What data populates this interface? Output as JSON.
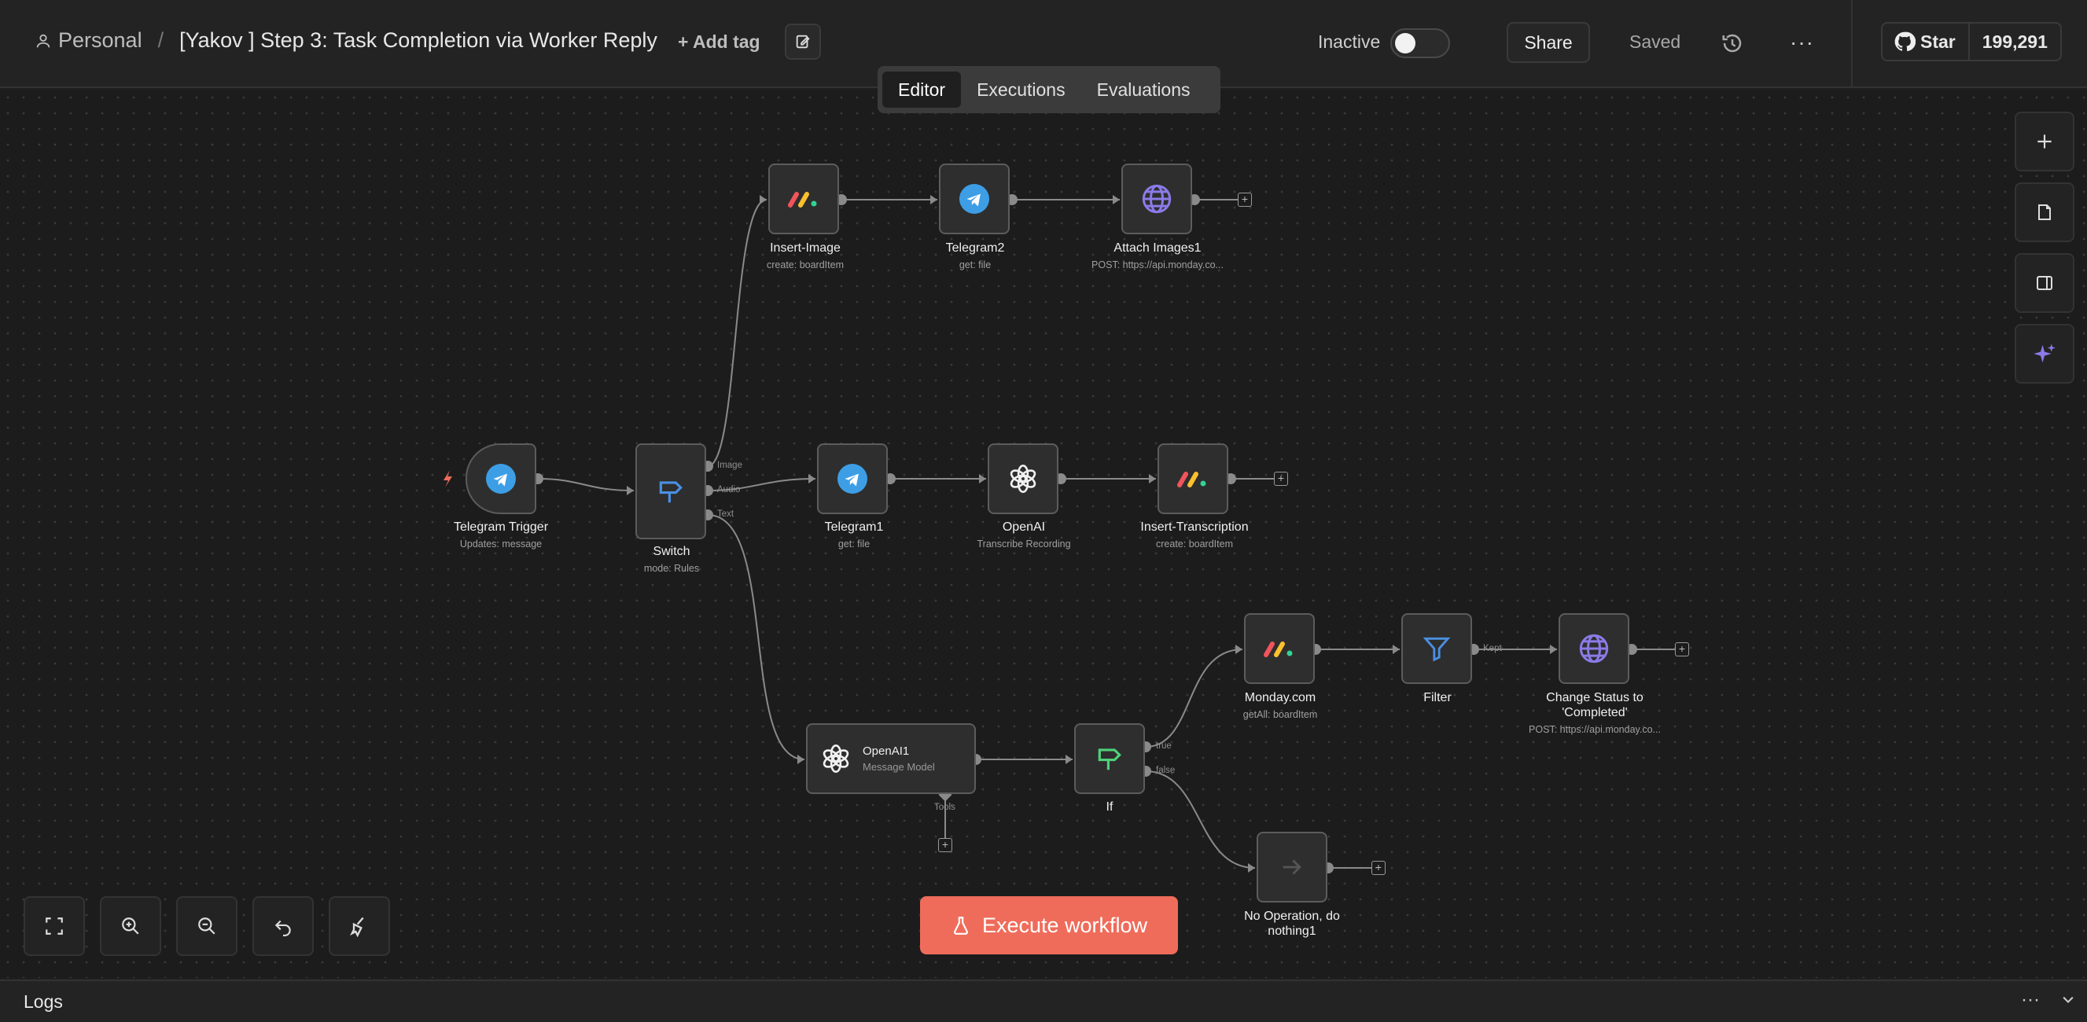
{
  "header": {
    "workspace": "Personal",
    "separator": "/",
    "workflow_title": "[Yakov ] Step 3: Task Completion via Worker Reply",
    "add_tag": "+ Add tag",
    "status_label": "Inactive",
    "active": false,
    "share": "Share",
    "save_state": "Saved",
    "more": "···",
    "github_star": "Star",
    "github_count": "199,291"
  },
  "tabs": [
    {
      "label": "Editor",
      "active": true
    },
    {
      "label": "Executions",
      "active": false
    },
    {
      "label": "Evaluations",
      "active": false
    }
  ],
  "nodes": {
    "telegram_trigger": {
      "label": "Telegram Trigger",
      "sub": "Updates: message",
      "icon": "telegram-icon"
    },
    "switch": {
      "label": "Switch",
      "sub": "mode: Rules",
      "icon": "switch-icon",
      "ports": [
        "Image",
        "Audio",
        "Text"
      ]
    },
    "insert_image": {
      "label": "Insert-Image",
      "sub": "create: boardItem",
      "icon": "monday-icon"
    },
    "telegram2": {
      "label": "Telegram2",
      "sub": "get: file",
      "icon": "telegram-icon"
    },
    "attach_images1": {
      "label": "Attach Images1",
      "sub": "POST: https://api.monday.co...",
      "icon": "globe-icon"
    },
    "telegram1": {
      "label": "Telegram1",
      "sub": "get: file",
      "icon": "telegram-icon"
    },
    "openai": {
      "label": "OpenAI",
      "sub": "Transcribe Recording",
      "icon": "openai-icon"
    },
    "insert_transcription": {
      "label": "Insert-Transcription",
      "sub": "create: boardItem",
      "icon": "monday-icon"
    },
    "openai1": {
      "label": "OpenAI1",
      "sub": "Message Model",
      "icon": "openai-icon",
      "port": "Tools"
    },
    "if": {
      "label": "If",
      "sub": "",
      "icon": "if-icon",
      "ports": [
        "true",
        "false"
      ]
    },
    "monday": {
      "label": "Monday.com",
      "sub": "getAll: boardItem",
      "icon": "monday-icon"
    },
    "filter": {
      "label": "Filter",
      "sub": "",
      "icon": "filter-icon",
      "port": "Kept"
    },
    "change_status": {
      "label": "Change Status to 'Completed'",
      "sub": "POST: https://api.monday.co...",
      "icon": "globe-icon"
    },
    "noop": {
      "label": "No Operation, do nothing1",
      "sub": "",
      "icon": "arrow-right-icon"
    }
  },
  "execute_button": "Execute workflow",
  "logs": {
    "label": "Logs",
    "more": "···"
  },
  "colors": {
    "accent": "#ef6c5b",
    "telegram": "#3d9ee6",
    "monday_red": "#f2545b",
    "monday_yellow": "#fbc02d",
    "monday_green": "#33d391",
    "globe": "#8b7be8",
    "filter": "#4a90e2",
    "if_green": "#4fd17a"
  }
}
